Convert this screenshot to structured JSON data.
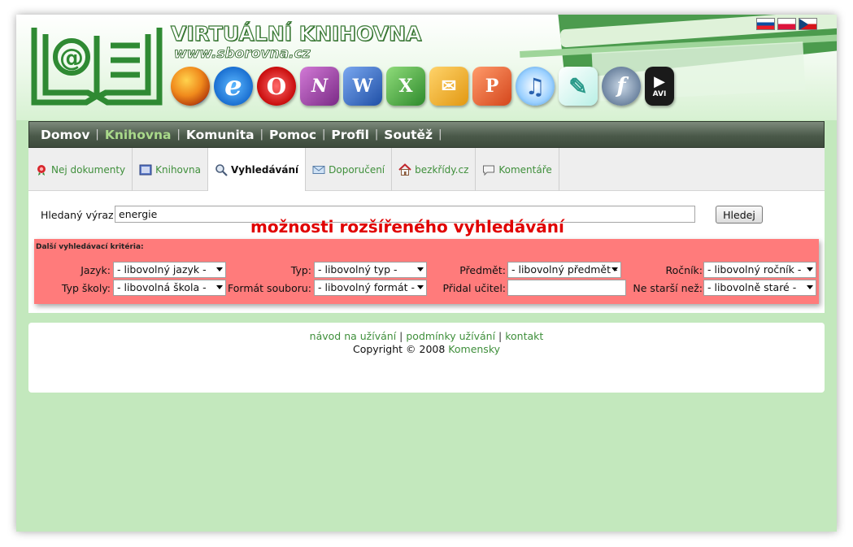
{
  "header": {
    "title": "VIRTUÁLNÍ KNIHOVNA",
    "url": "www.sborovna.cz",
    "app_icons": [
      "firefox-icon",
      "internet-explorer-icon",
      "opera-icon",
      "onenote-icon",
      "word-icon",
      "excel-icon",
      "outlook-icon",
      "powerpoint-icon",
      "itunes-icon",
      "feather-icon",
      "flash-icon",
      "avi-icon"
    ],
    "avi_text": "AVI",
    "flags": [
      "slovak-flag-icon",
      "polish-flag-icon",
      "czech-flag-icon"
    ]
  },
  "main_nav": {
    "items": [
      {
        "label": "Domov",
        "active": false
      },
      {
        "label": "Knihovna",
        "active": true
      },
      {
        "label": "Komunita",
        "active": false
      },
      {
        "label": "Pomoc",
        "active": false
      },
      {
        "label": "Profil",
        "active": false
      },
      {
        "label": "Soutěž",
        "active": false
      }
    ],
    "separator": "|"
  },
  "tabs": {
    "items": [
      {
        "label": "Nej dokumenty",
        "icon": "rosette-icon"
      },
      {
        "label": "Knihovna",
        "icon": "book-icon"
      },
      {
        "label": "Vyhledávání",
        "icon": "magnifier-icon",
        "active": true
      },
      {
        "label": "Doporučení",
        "icon": "envelope-icon"
      },
      {
        "label": "bezkřídy.cz",
        "icon": "house-icon"
      },
      {
        "label": "Komentáře",
        "icon": "speech-bubble-icon"
      }
    ]
  },
  "search": {
    "label": "Hledaný výraz:",
    "value": "energie",
    "button": "Hledej"
  },
  "annotation": "možnosti rozšířeného vyhledávání",
  "criteria": {
    "title": "Další vyhledávací kritéria:",
    "jazyk_label": "Jazyk:",
    "jazyk_value": "- libovolný jazyk -",
    "typ_label": "Typ:",
    "typ_value": "- libovolný typ -",
    "predmet_label": "Předmět:",
    "predmet_value": "- libovolný předmět -",
    "rocnik_label": "Ročník:",
    "rocnik_value": "- libovolný ročník -",
    "typ_skoly_label": "Typ školy:",
    "typ_skoly_value": "- libovolná škola -",
    "format_label": "Formát souboru:",
    "format_value": "- libovolný formát -",
    "pridal_label": "Přidal učitel:",
    "pridal_value": "",
    "nestarsi_label": "Ne starší než:",
    "nestarsi_value": "- libovolně staré -"
  },
  "footer": {
    "link1": "návod na užívání",
    "sep": "|",
    "link2": "podmínky užívání",
    "link3": "kontakt",
    "copyright": "Copyright © 2008",
    "company": "Komensky"
  },
  "colors": {
    "page_bg": "#c3e8bd",
    "nav_bg": "#4b5a4a",
    "nav_active": "#a9d98a",
    "link": "#3f8f3b",
    "criteria_bg": "#ff7b7b",
    "annotation": "#e00000"
  }
}
